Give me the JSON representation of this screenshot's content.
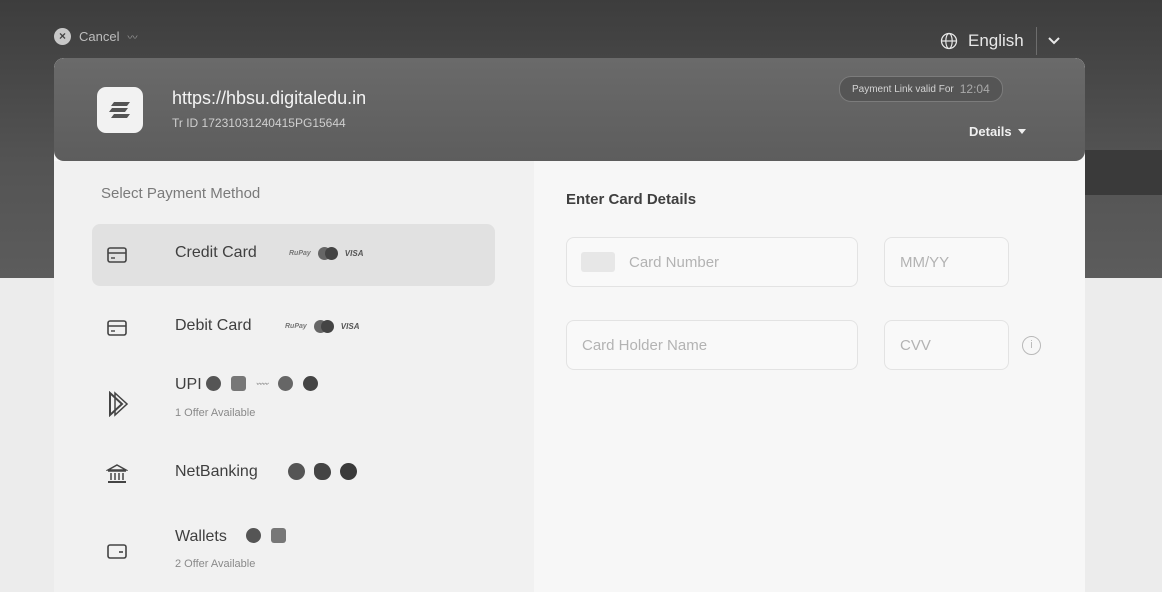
{
  "topbar": {
    "cancel_label": "Cancel",
    "cancel_icon": "close-circle-icon",
    "language_label": "English",
    "language_icon": "globe-icon"
  },
  "header": {
    "merchant_url": "https://hbsu.digitaledu.in",
    "transaction_id": "Tr ID 17231031240415PG15644",
    "validity_label": "Payment Link valid For",
    "validity_time": "12:04",
    "details_label": "Details"
  },
  "payment_methods": {
    "title": "Select Payment Method",
    "items": [
      {
        "label": "Credit Card",
        "icon": "credit-card-icon",
        "brands": [
          "RuPay",
          "mastercard",
          "VISA"
        ],
        "active": true
      },
      {
        "label": "Debit Card",
        "icon": "debit-card-icon",
        "brands": [
          "RuPay",
          "mastercard",
          "VISA"
        ],
        "active": false
      },
      {
        "label": "UPI",
        "icon": "upi-icon",
        "sub": "1 Offer Available",
        "brands": [
          "paytm",
          "phonepe",
          "amazon pay",
          "bhim",
          "gpay"
        ],
        "active": false
      },
      {
        "label": "NetBanking",
        "icon": "bank-icon",
        "brands": [
          "sbi",
          "icici",
          "hdfc"
        ],
        "active": false
      },
      {
        "label": "Wallets",
        "icon": "wallet-icon",
        "sub": "2 Offer Available",
        "brands": [
          "paytm",
          "phonepe"
        ],
        "active": false
      }
    ]
  },
  "card_form": {
    "title": "Enter Card Details",
    "card_number_placeholder": "Card Number",
    "expiry_placeholder": "MM/YY",
    "holder_placeholder": "Card Holder Name",
    "cvv_placeholder": "CVV"
  },
  "colors": {
    "header_bg": "#5f5f5f",
    "panel_bg": "#f1f1f1",
    "active_item_bg": "#e1e1e1",
    "text_dark": "#3f3f3f"
  }
}
